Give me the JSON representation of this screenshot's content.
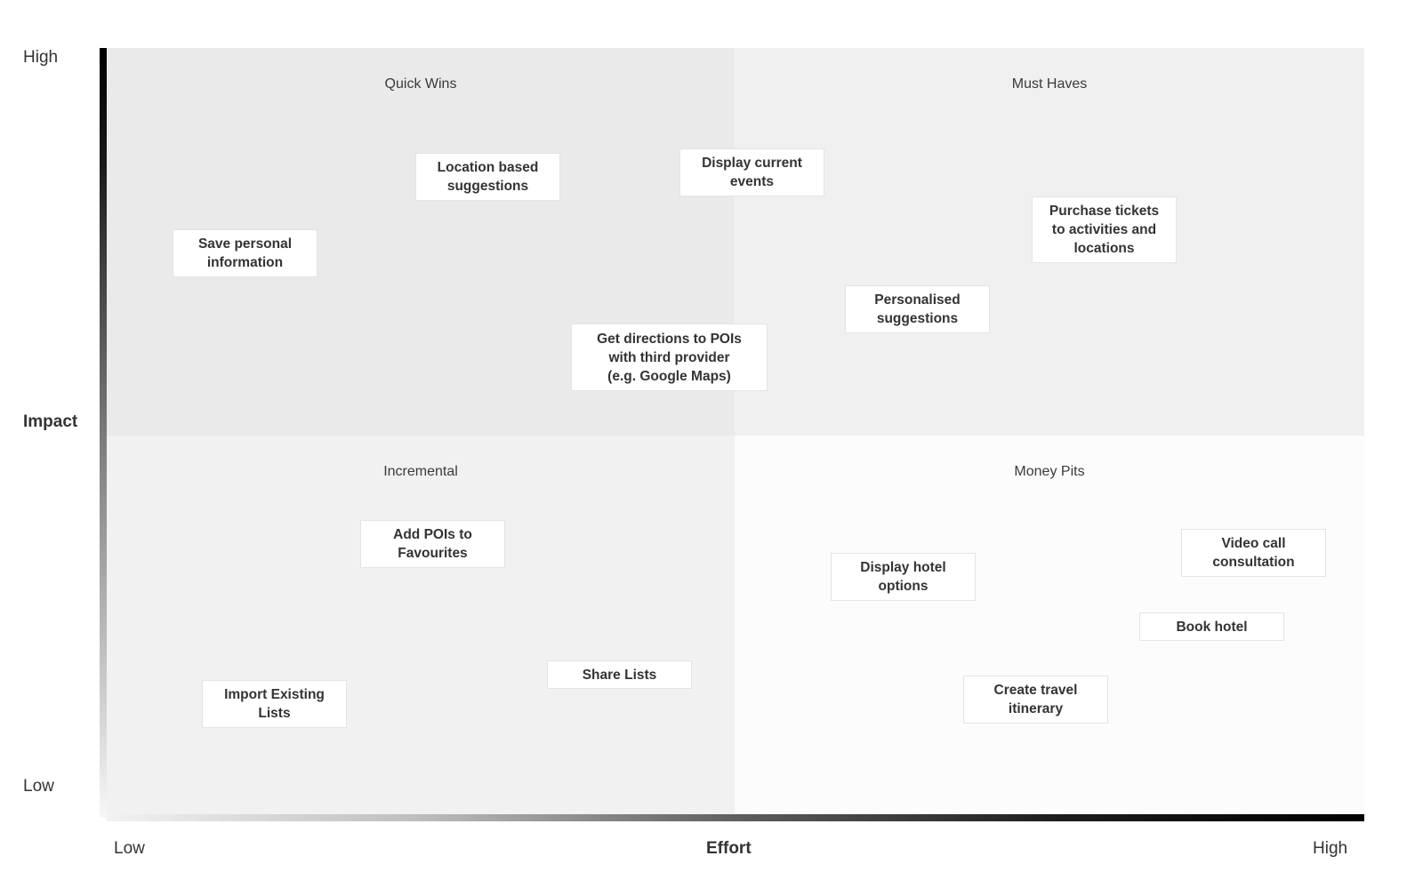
{
  "axes": {
    "y": {
      "title": "Impact",
      "high_label": "High",
      "low_label": "Low"
    },
    "x": {
      "title": "Effort",
      "low_label": "Low",
      "high_label": "High"
    }
  },
  "quadrants": {
    "top_left": {
      "title": "Quick Wins",
      "color": "#eaeaeb"
    },
    "top_right": {
      "title": "Must Haves",
      "color": "#f0f0f1"
    },
    "bottom_left": {
      "title": "Incremental",
      "color": "#f1f1f2"
    },
    "bottom_right": {
      "title": "Money Pits",
      "color": "#fcfcfc"
    }
  },
  "cards": [
    {
      "id": "save-personal-information",
      "label": "Save personal\ninformation",
      "quadrant": "Quick Wins"
    },
    {
      "id": "location-based-suggestions",
      "label": "Location based\nsuggestions",
      "quadrant": "Quick Wins"
    },
    {
      "id": "display-current-events",
      "label": "Display current\nevents",
      "quadrant": "Quick Wins"
    },
    {
      "id": "get-directions",
      "label": "Get directions to POIs\nwith third provider\n(e.g. Google Maps)",
      "quadrant": "Quick Wins"
    },
    {
      "id": "purchase-tickets",
      "label": "Purchase tickets\nto activities and\nlocations",
      "quadrant": "Must Haves"
    },
    {
      "id": "personalised-suggestions",
      "label": "Personalised\nsuggestions",
      "quadrant": "Must Haves"
    },
    {
      "id": "add-pois-to-favourites",
      "label": "Add POIs to\nFavourites",
      "quadrant": "Incremental"
    },
    {
      "id": "share-lists",
      "label": "Share Lists",
      "quadrant": "Incremental"
    },
    {
      "id": "import-existing-lists",
      "label": "Import Existing\nLists",
      "quadrant": "Incremental"
    },
    {
      "id": "display-hotel-options",
      "label": "Display hotel\noptions",
      "quadrant": "Money Pits"
    },
    {
      "id": "video-call-consultation",
      "label": "Video call\nconsultation",
      "quadrant": "Money Pits"
    },
    {
      "id": "book-hotel",
      "label": "Book hotel",
      "quadrant": "Money Pits"
    },
    {
      "id": "create-travel-itinerary",
      "label": "Create travel\nitinerary",
      "quadrant": "Money Pits"
    }
  ]
}
